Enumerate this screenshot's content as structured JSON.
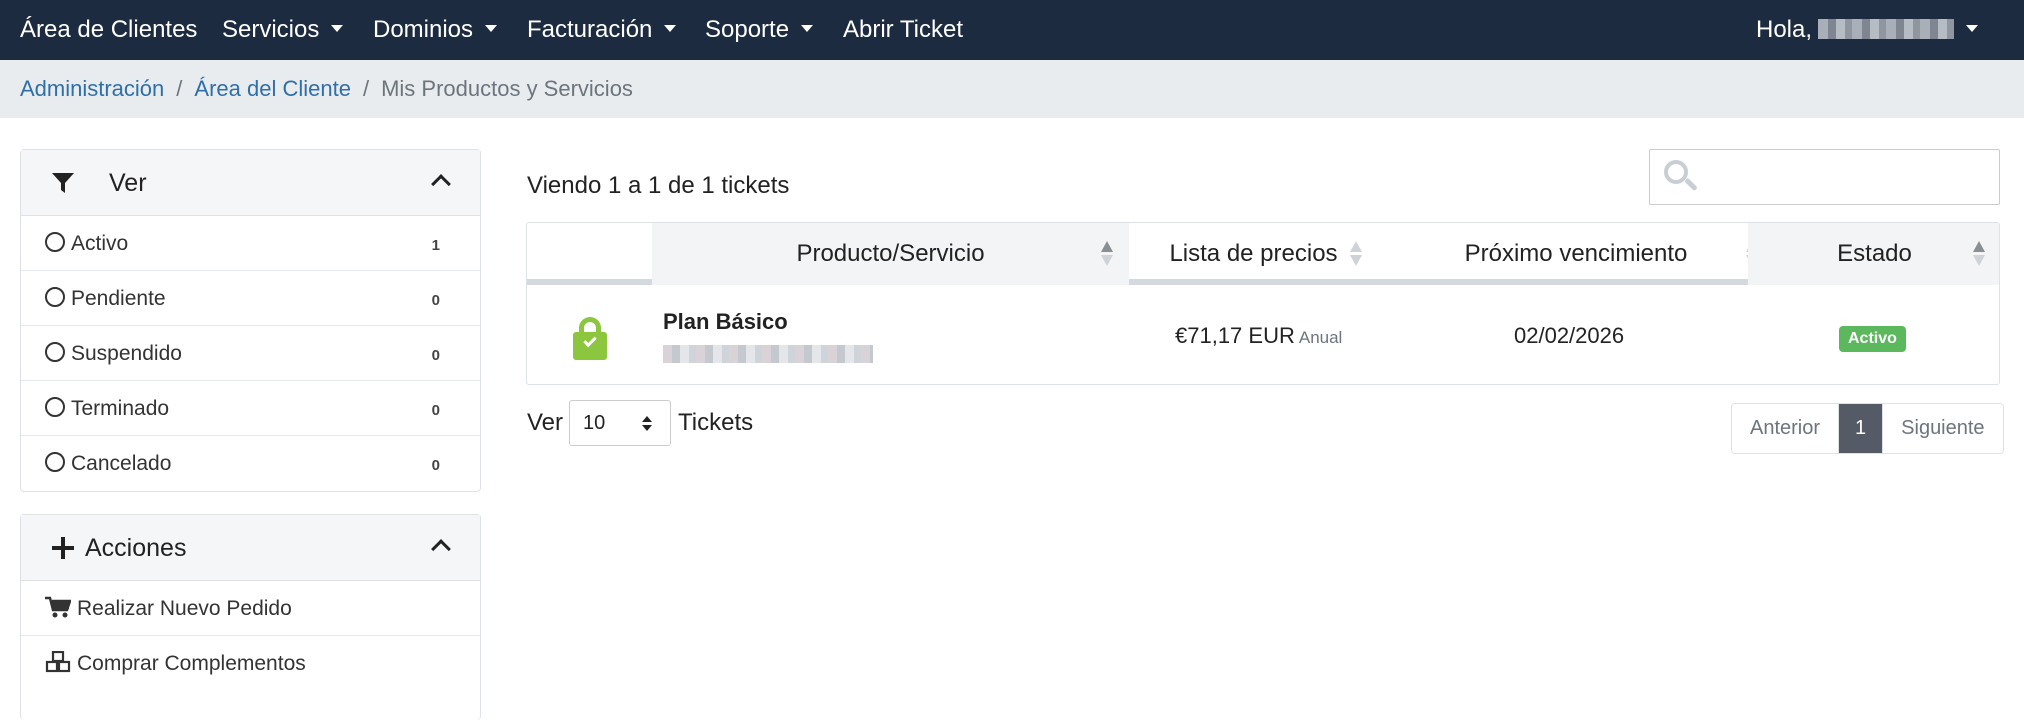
{
  "nav": {
    "brand": "Área de Clientes",
    "menu": [
      {
        "label": "Servicios",
        "dropdown": true
      },
      {
        "label": "Dominios",
        "dropdown": true
      },
      {
        "label": "Facturación",
        "dropdown": true
      },
      {
        "label": "Soporte",
        "dropdown": true
      },
      {
        "label": "Abrir Ticket",
        "dropdown": false
      }
    ],
    "greeting": "Hola,"
  },
  "breadcrumb": {
    "items": [
      "Administración",
      "Área del Cliente"
    ],
    "current": "Mis Productos y Servicios"
  },
  "filter_panel": {
    "title": "Ver",
    "icon": "filter-icon",
    "items": [
      {
        "label": "Activo",
        "count": "1"
      },
      {
        "label": "Pendiente",
        "count": "0"
      },
      {
        "label": "Suspendido",
        "count": "0"
      },
      {
        "label": "Terminado",
        "count": "0"
      },
      {
        "label": "Cancelado",
        "count": "0"
      }
    ]
  },
  "actions_panel": {
    "title": "Acciones",
    "icon": "plus-icon",
    "items": [
      {
        "label": "Realizar Nuevo Pedido",
        "icon": "cart-icon"
      },
      {
        "label": "Comprar Complementos",
        "icon": "cubes-icon"
      }
    ]
  },
  "table": {
    "showing_text": "Viendo 1 a 1 de 1 tickets",
    "search": {
      "placeholder": "",
      "value": ""
    },
    "columns": [
      "Producto/Servicio",
      "Lista de precios",
      "Próximo vencimiento",
      "Estado"
    ],
    "rows": [
      {
        "product": "Plan Básico",
        "price": "€71,17 EUR",
        "cycle": "Anual",
        "next_due": "02/02/2026",
        "status": "Activo"
      }
    ]
  },
  "per_page": {
    "label_before": "Ver",
    "value": "10",
    "label_after": "Tickets"
  },
  "pagination": {
    "previous": "Anterior",
    "current": "1",
    "next": "Siguiente"
  },
  "colors": {
    "nav_bg": "#1c2b3f",
    "link": "#2f6fa8",
    "status_active": "#5cb85c",
    "lock_icon": "#8cc63f"
  }
}
